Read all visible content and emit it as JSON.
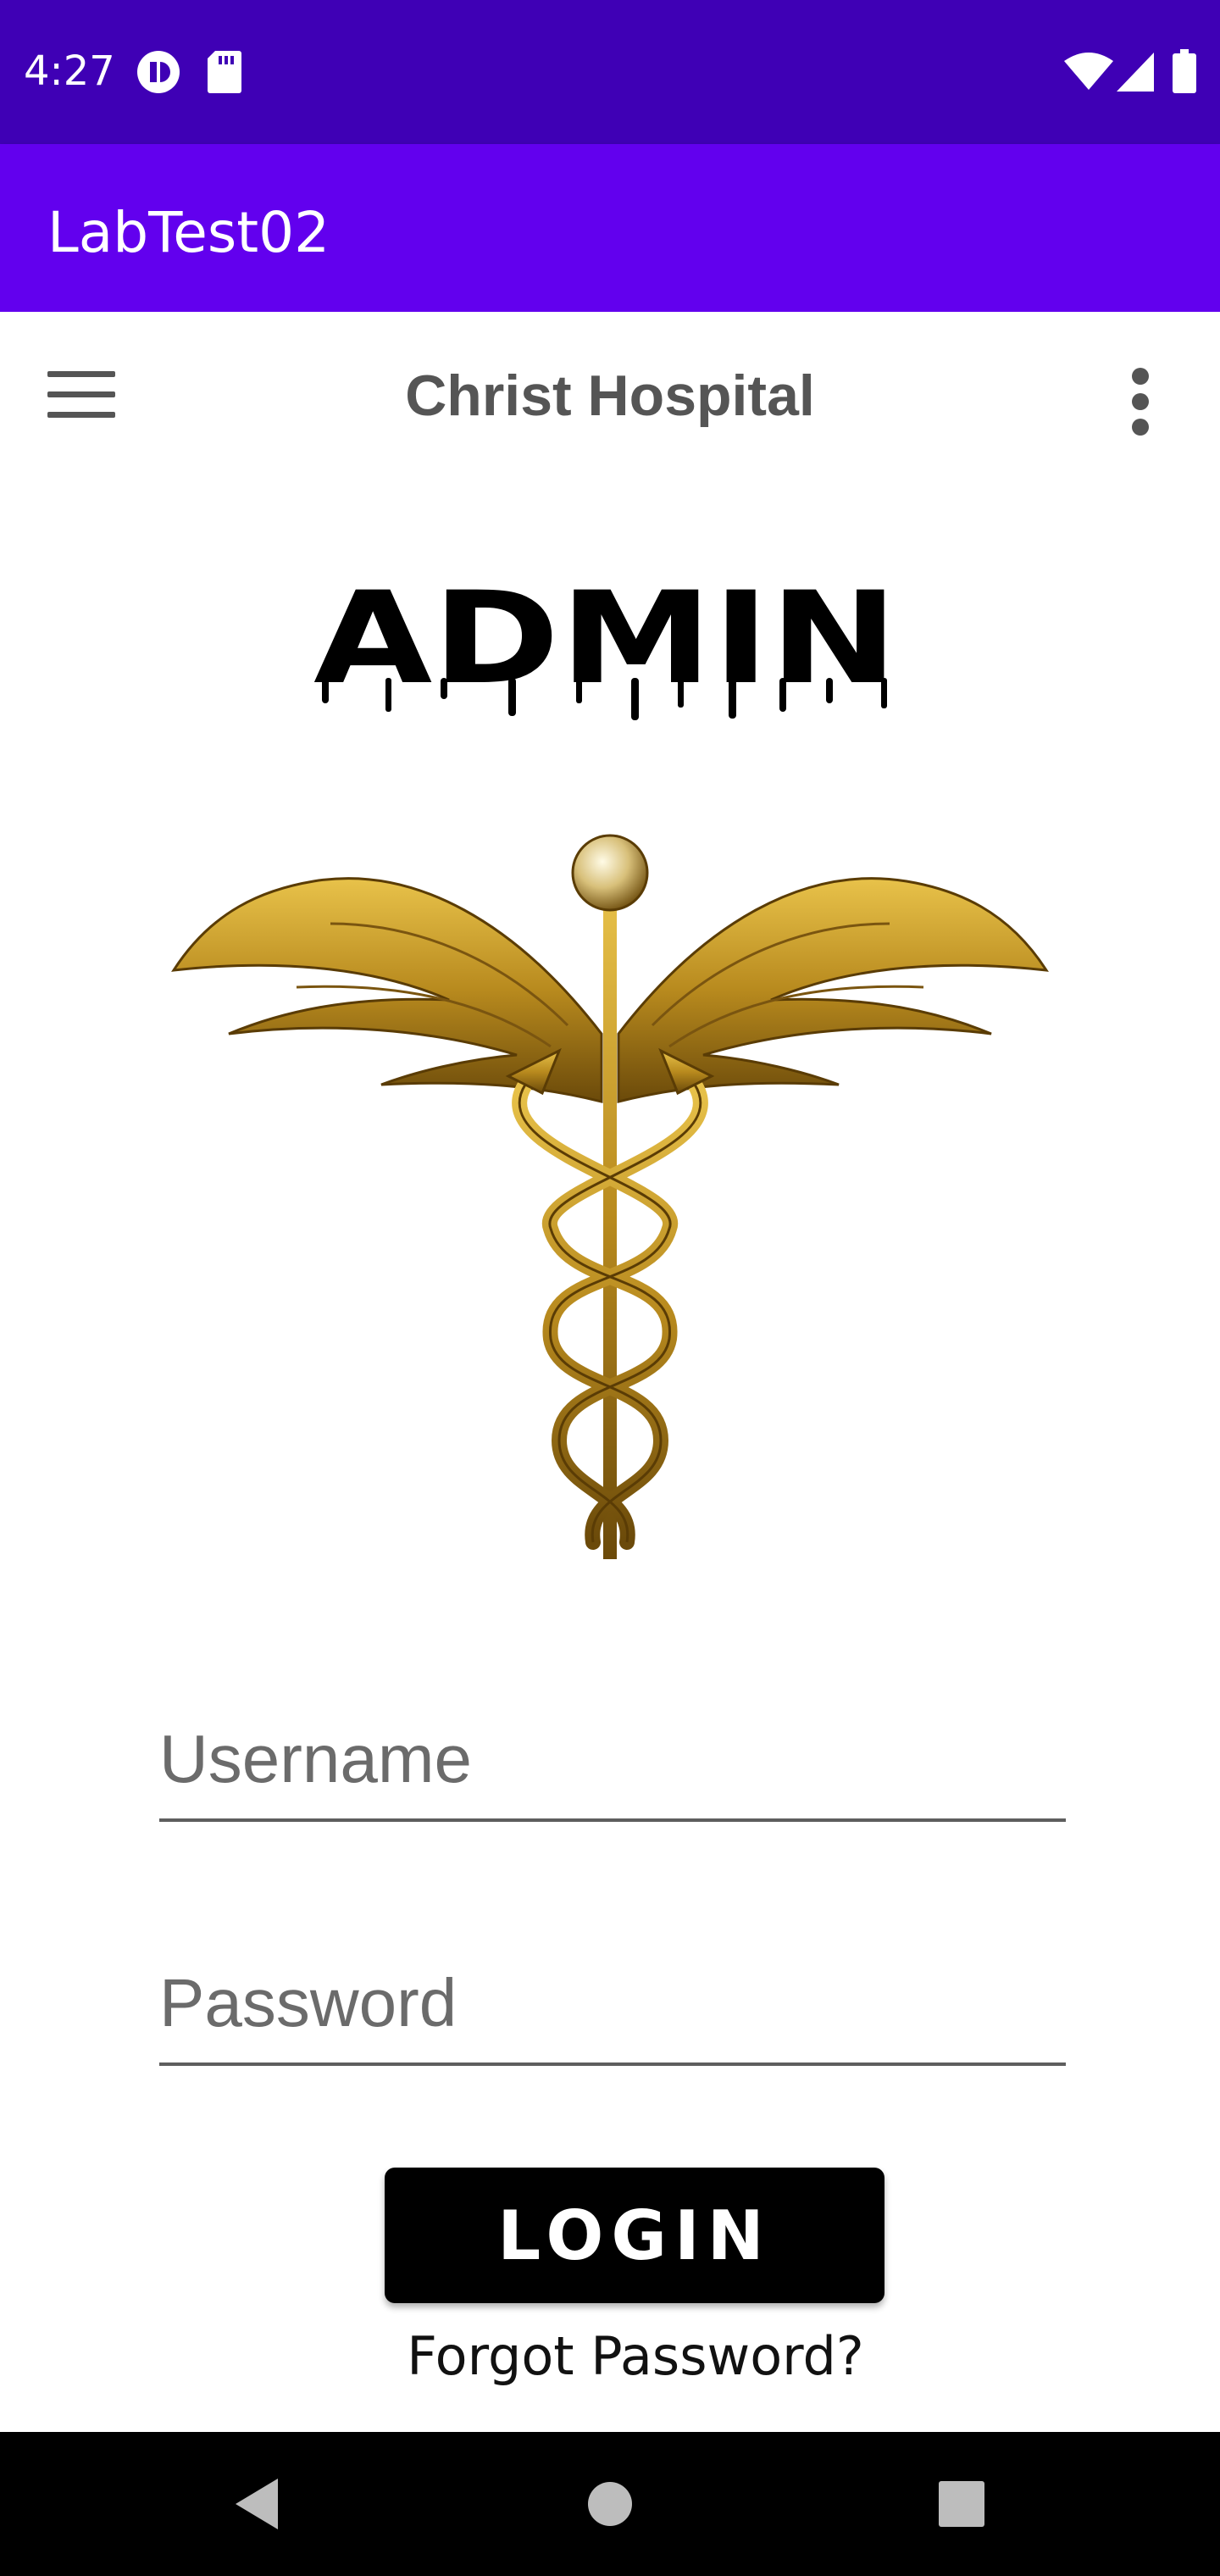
{
  "status_bar": {
    "time": "4:27",
    "icons": [
      "notification-app-icon",
      "sd-card-icon",
      "wifi-icon",
      "cellular-signal-icon",
      "battery-icon"
    ]
  },
  "app_bar": {
    "title": "LabTest02",
    "color": "#6200ee"
  },
  "toolbar": {
    "title": "Christ Hospital",
    "menu_icon": "hamburger-menu-icon",
    "overflow_icon": "more-vert-icon"
  },
  "header": {
    "title": "ADMIN"
  },
  "logo": {
    "icon": "caduceus-icon"
  },
  "form": {
    "username_placeholder": "Username",
    "password_placeholder": "Password",
    "login_label": "LOGIN",
    "forgot_label": "Forgot Password?"
  },
  "nav_bar": {
    "icons": [
      "back-icon",
      "home-icon",
      "recents-icon"
    ]
  }
}
